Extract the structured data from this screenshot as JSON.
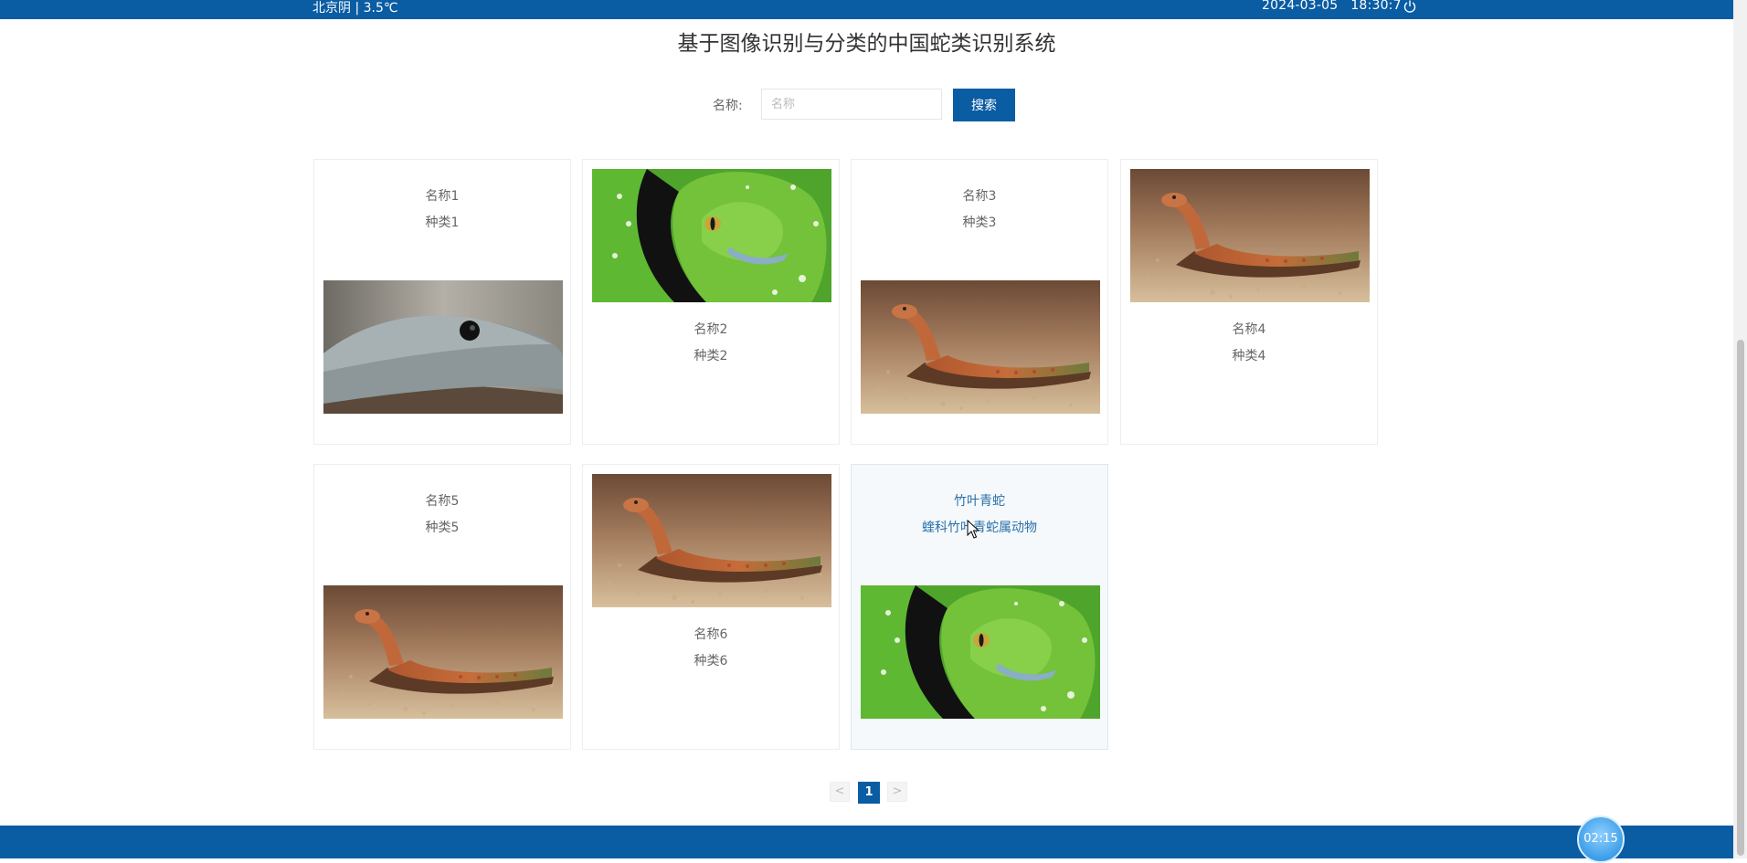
{
  "topbar": {
    "weather": "北京阴 | 3.5℃",
    "date": "2024-03-05",
    "time": "18:30:7",
    "power_icon": "power-icon"
  },
  "page_title": "基于图像识别与分类的中国蛇类识别系统",
  "search": {
    "label": "名称:",
    "placeholder": "名称",
    "value": "",
    "button_label": "搜索"
  },
  "cards": [
    {
      "name": "名称1",
      "kind": "种类1",
      "image": "grey-snake-photo"
    },
    {
      "name": "名称2",
      "kind": "种类2",
      "image": "green-snake-photo"
    },
    {
      "name": "名称3",
      "kind": "种类3",
      "image": "brown-snake-photo"
    },
    {
      "name": "名称4",
      "kind": "种类4",
      "image": "brown-snake-photo"
    },
    {
      "name": "名称5",
      "kind": "种类5",
      "image": "brown-snake-photo"
    },
    {
      "name": "名称6",
      "kind": "种类6",
      "image": "brown-snake-photo"
    },
    {
      "name": "竹叶青蛇",
      "kind": "蝰科竹叶青蛇属动物",
      "image": "green-snake-photo"
    }
  ],
  "pagination": {
    "prev": "<",
    "current": "1",
    "next": ">"
  },
  "timer": "02:15",
  "colors": {
    "brand": "#0a5ca3",
    "active_text": "#2a6fa8",
    "card_border": "#eeeeee"
  }
}
